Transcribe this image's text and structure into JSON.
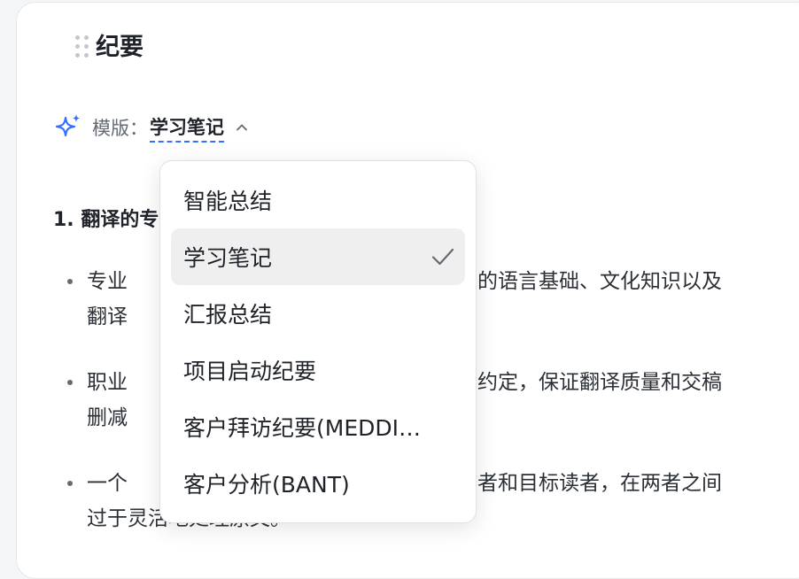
{
  "card": {
    "title": "纪要"
  },
  "template": {
    "label": "模版：",
    "value": "学习笔记",
    "icon": "sparkle-icon",
    "accent_color": "#3370ff"
  },
  "content": {
    "heading": "1. 翻译的专",
    "bullets": [
      {
        "line1": "专业",
        "line1_rest": "实的语言基础、文化知识以及",
        "line2": "翻译"
      },
      {
        "line1": "职业",
        "line1_rest": "同约定，保证翻译质量和交稿",
        "line2": "删减"
      },
      {
        "line1": "一个",
        "line1_rest": "作者和目标读者，在两者之间",
        "line2": "过于灵活地处理原文。"
      }
    ]
  },
  "dropdown": {
    "items": [
      {
        "label": "智能总结",
        "selected": false
      },
      {
        "label": "学习笔记",
        "selected": true
      },
      {
        "label": "汇报总结",
        "selected": false
      },
      {
        "label": "项目启动纪要",
        "selected": false
      },
      {
        "label": "客户拜访纪要(MEDDI…",
        "selected": false
      },
      {
        "label": "客户分析(BANT)",
        "selected": false
      }
    ]
  }
}
